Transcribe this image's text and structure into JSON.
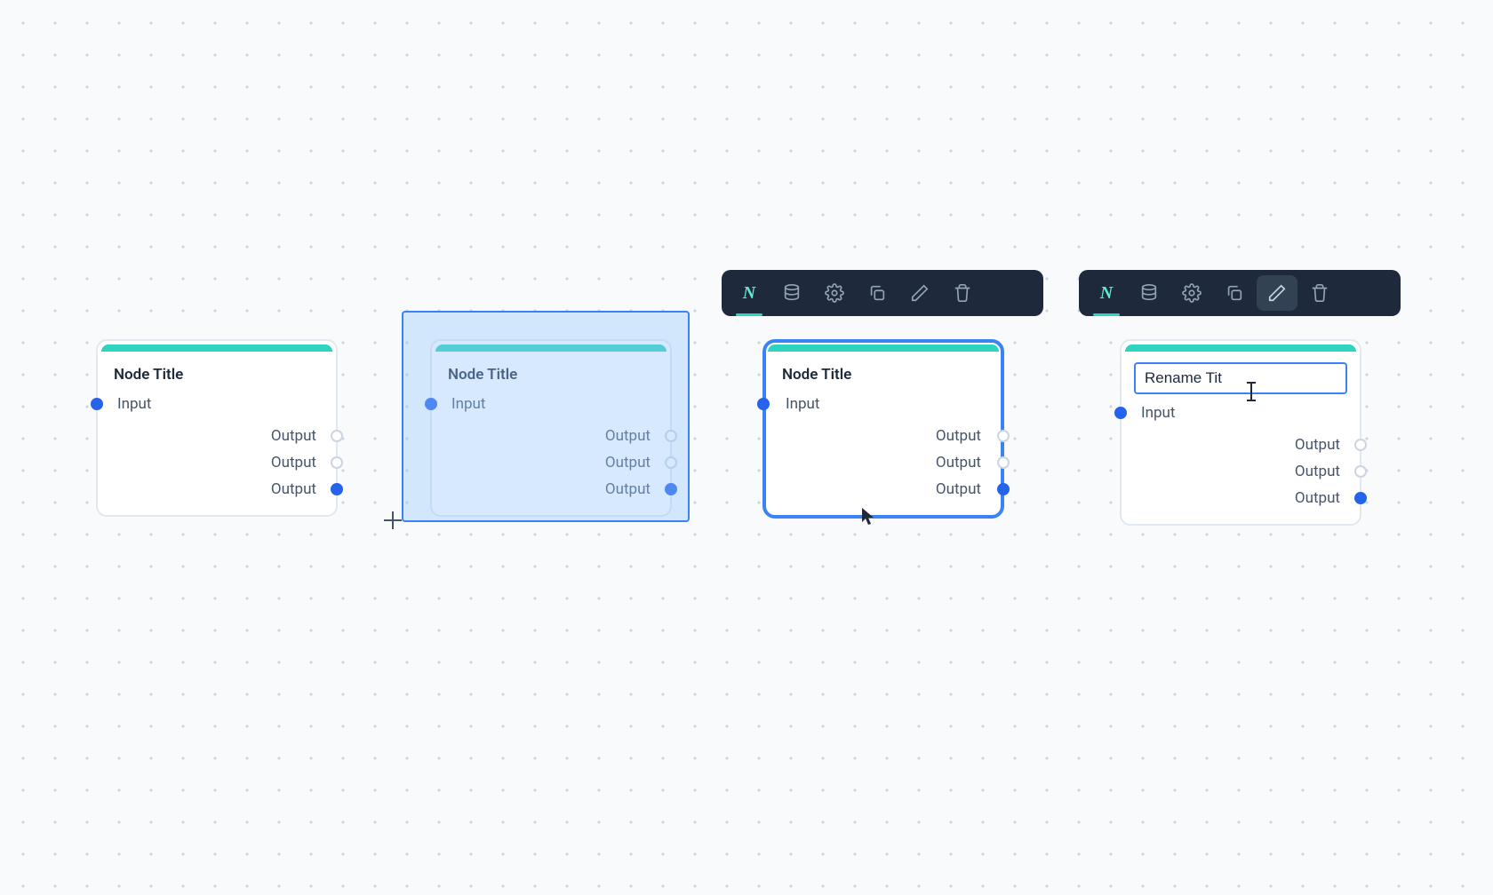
{
  "nodes": {
    "default": {
      "title": "Node Title",
      "input_label": "Input",
      "outputs": [
        "Output",
        "Output",
        "Output"
      ]
    },
    "rubber_select": {
      "title": "Node Title",
      "input_label": "Input",
      "outputs": [
        "Output",
        "Output",
        "Output"
      ]
    },
    "selected": {
      "title": "Node Title",
      "input_label": "Input",
      "outputs": [
        "Output",
        "Output",
        "Output"
      ]
    },
    "editing": {
      "title_value": "Rename Tit",
      "input_label": "Input",
      "outputs": [
        "Output",
        "Output",
        "Output"
      ]
    }
  },
  "toolbar": {
    "items": [
      {
        "name": "node-type",
        "glyph": "N"
      },
      {
        "name": "database"
      },
      {
        "name": "settings"
      },
      {
        "name": "duplicate"
      },
      {
        "name": "rename"
      },
      {
        "name": "delete"
      }
    ]
  }
}
